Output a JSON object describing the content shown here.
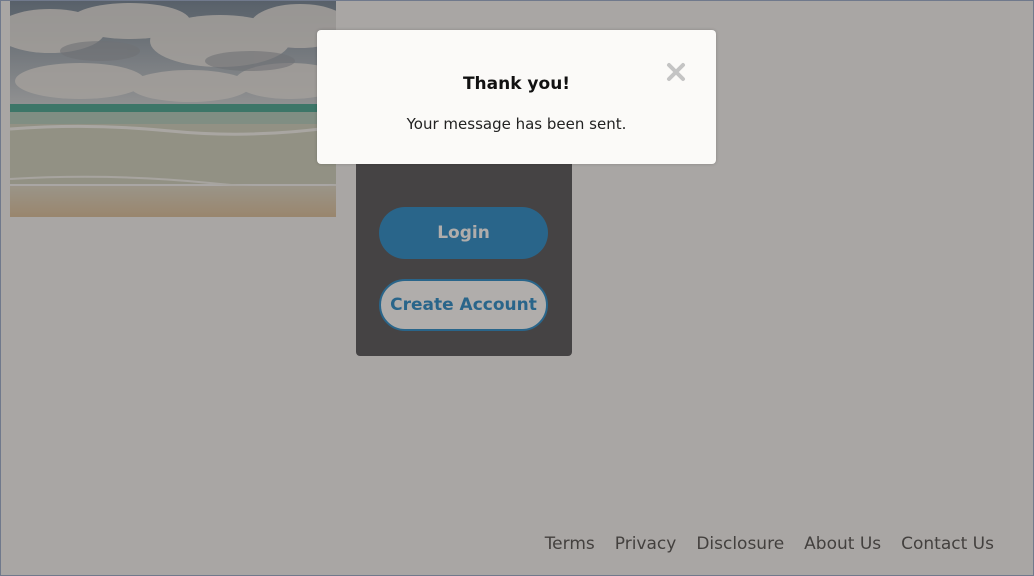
{
  "hero": {
    "image": "beach-photo"
  },
  "auth_card": {
    "login_label": "Login",
    "create_account_label": "Create Account"
  },
  "footer": {
    "links": [
      "Terms",
      "Privacy",
      "Disclosure",
      "About Us",
      "Contact Us"
    ]
  },
  "modal": {
    "title": "Thank you!",
    "message": "Your message has been sent.",
    "close_icon": "close-icon"
  },
  "colors": {
    "brand_blue": "#0a7dc4",
    "card_dark": "#3d3f44",
    "overlay": "rgba(80,74,68,0.45)"
  }
}
